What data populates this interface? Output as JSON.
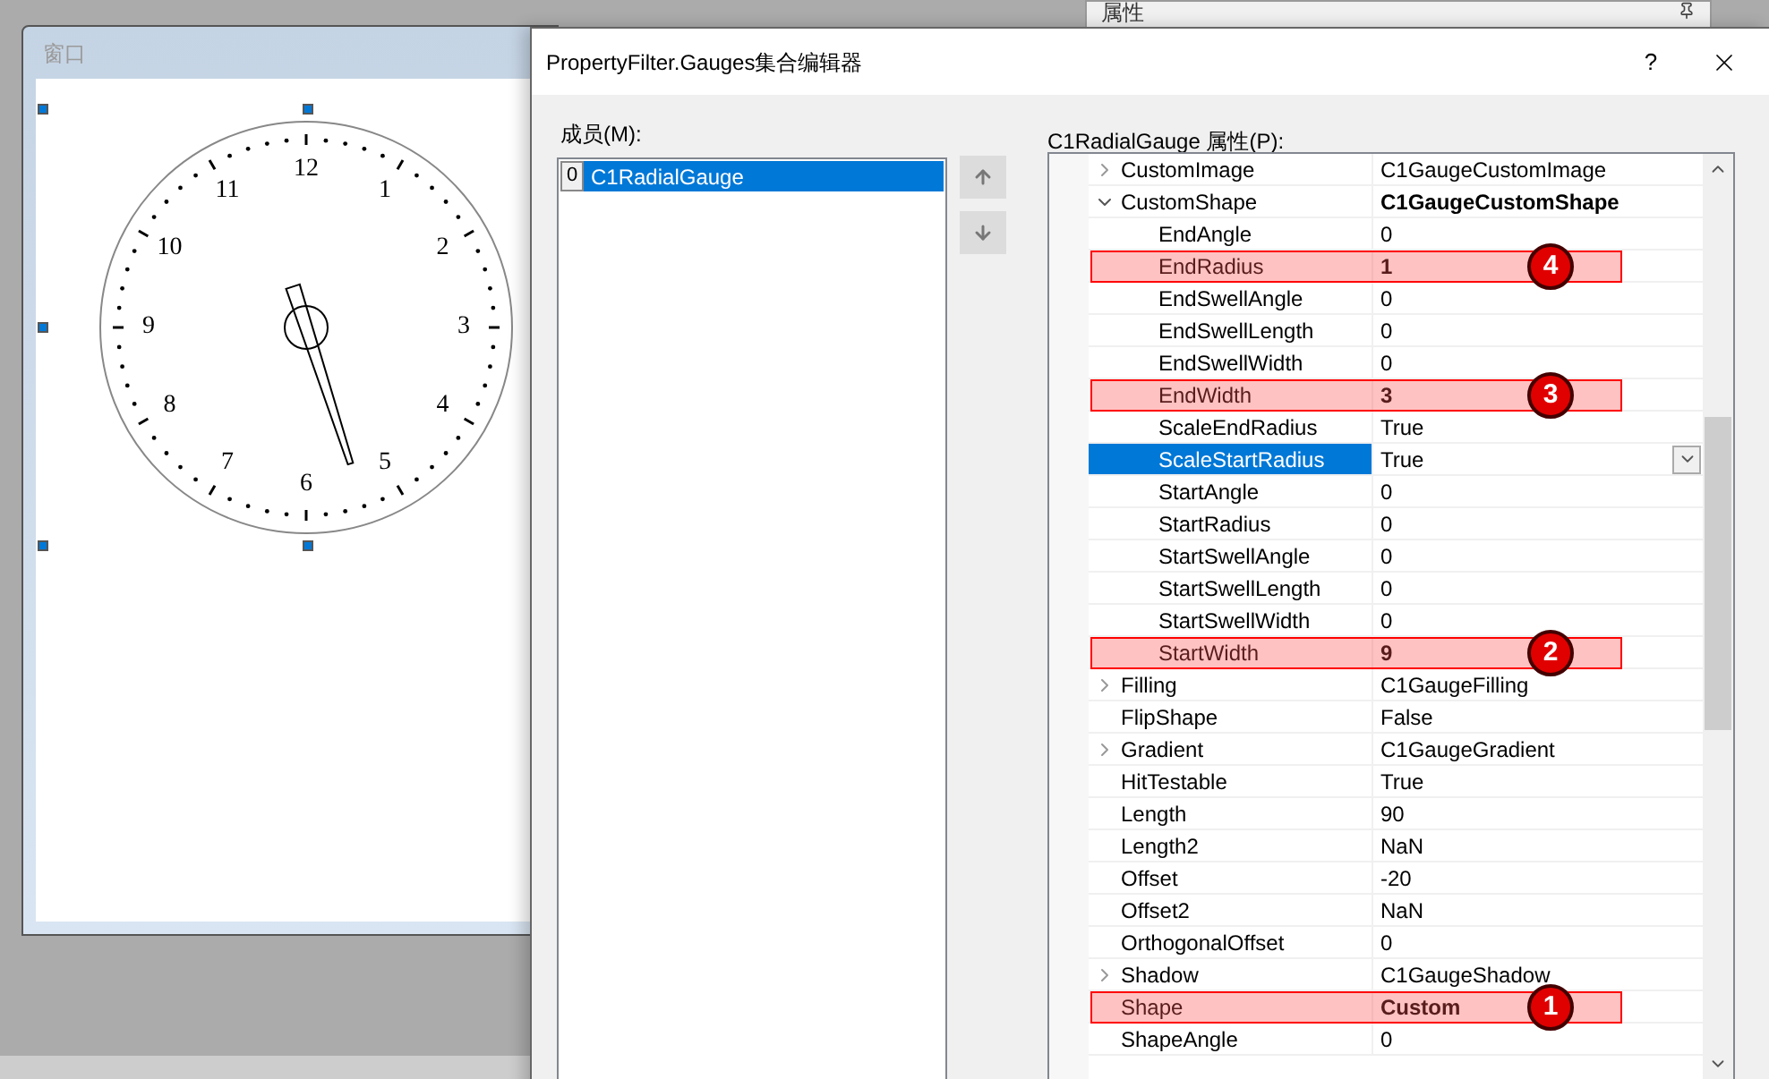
{
  "background_panel": {
    "title": "属性"
  },
  "form_window": {
    "title": "窗口",
    "dial_numbers": [
      "12",
      "1",
      "2",
      "3",
      "4",
      "5",
      "6",
      "7",
      "8",
      "9",
      "10",
      "11"
    ]
  },
  "dialog": {
    "title": "PropertyFilter.Gauges集合编辑器",
    "help": "?",
    "members_label": "成员(M):",
    "members": [
      {
        "index": "0",
        "name": "C1RadialGauge",
        "selected": true
      }
    ],
    "properties_label": "C1RadialGauge 属性(P):",
    "properties": [
      {
        "kind": "group",
        "name": "CustomImage",
        "value": "C1GaugeCustomImage",
        "expanded": false,
        "selected": false,
        "bold": false
      },
      {
        "kind": "group",
        "name": "CustomShape",
        "value": "C1GaugeCustomShape",
        "expanded": true,
        "selected": false,
        "bold": true,
        "children": [
          {
            "kind": "property",
            "name": "EndAngle",
            "value": "0",
            "selected": false,
            "bold": false
          },
          {
            "kind": "property",
            "name": "EndRadius",
            "value": "1",
            "selected": false,
            "bold": true,
            "callout": "4"
          },
          {
            "kind": "property",
            "name": "EndSwellAngle",
            "value": "0",
            "selected": false,
            "bold": false
          },
          {
            "kind": "property",
            "name": "EndSwellLength",
            "value": "0",
            "selected": false,
            "bold": false
          },
          {
            "kind": "property",
            "name": "EndSwellWidth",
            "value": "0",
            "selected": false,
            "bold": false
          },
          {
            "kind": "property",
            "name": "EndWidth",
            "value": "3",
            "selected": false,
            "bold": true,
            "callout": "3"
          },
          {
            "kind": "property",
            "name": "ScaleEndRadius",
            "value": "True",
            "selected": false,
            "bold": false
          },
          {
            "kind": "property",
            "name": "ScaleStartRadius",
            "value": "True",
            "selected": true,
            "bold": false
          },
          {
            "kind": "property",
            "name": "StartAngle",
            "value": "0",
            "selected": false,
            "bold": false
          },
          {
            "kind": "property",
            "name": "StartRadius",
            "value": "0",
            "selected": false,
            "bold": false
          },
          {
            "kind": "property",
            "name": "StartSwellAngle",
            "value": "0",
            "selected": false,
            "bold": false
          },
          {
            "kind": "property",
            "name": "StartSwellLength",
            "value": "0",
            "selected": false,
            "bold": false
          },
          {
            "kind": "property",
            "name": "StartSwellWidth",
            "value": "0",
            "selected": false,
            "bold": false
          },
          {
            "kind": "property",
            "name": "StartWidth",
            "value": "9",
            "selected": false,
            "bold": true,
            "callout": "2"
          }
        ]
      },
      {
        "kind": "group",
        "name": "Filling",
        "value": "C1GaugeFilling",
        "expanded": false,
        "selected": false,
        "bold": false
      },
      {
        "kind": "property",
        "name": "FlipShape",
        "value": "False",
        "selected": false,
        "bold": false
      },
      {
        "kind": "group",
        "name": "Gradient",
        "value": "C1GaugeGradient",
        "expanded": false,
        "selected": false,
        "bold": false
      },
      {
        "kind": "property",
        "name": "HitTestable",
        "value": "True",
        "selected": false,
        "bold": false
      },
      {
        "kind": "property",
        "name": "Length",
        "value": "90",
        "selected": false,
        "bold": false
      },
      {
        "kind": "property",
        "name": "Length2",
        "value": "NaN",
        "selected": false,
        "bold": false
      },
      {
        "kind": "property",
        "name": "Offset",
        "value": "-20",
        "selected": false,
        "bold": false
      },
      {
        "kind": "property",
        "name": "Offset2",
        "value": "NaN",
        "selected": false,
        "bold": false
      },
      {
        "kind": "property",
        "name": "OrthogonalOffset",
        "value": "0",
        "selected": false,
        "bold": false
      },
      {
        "kind": "group",
        "name": "Shadow",
        "value": "C1GaugeShadow",
        "expanded": false,
        "selected": false,
        "bold": false
      },
      {
        "kind": "property",
        "name": "Shape",
        "value": "Custom",
        "selected": false,
        "bold": true,
        "callout": "1"
      },
      {
        "kind": "property",
        "name": "ShapeAngle",
        "value": "0",
        "selected": false,
        "bold": false
      }
    ]
  }
}
